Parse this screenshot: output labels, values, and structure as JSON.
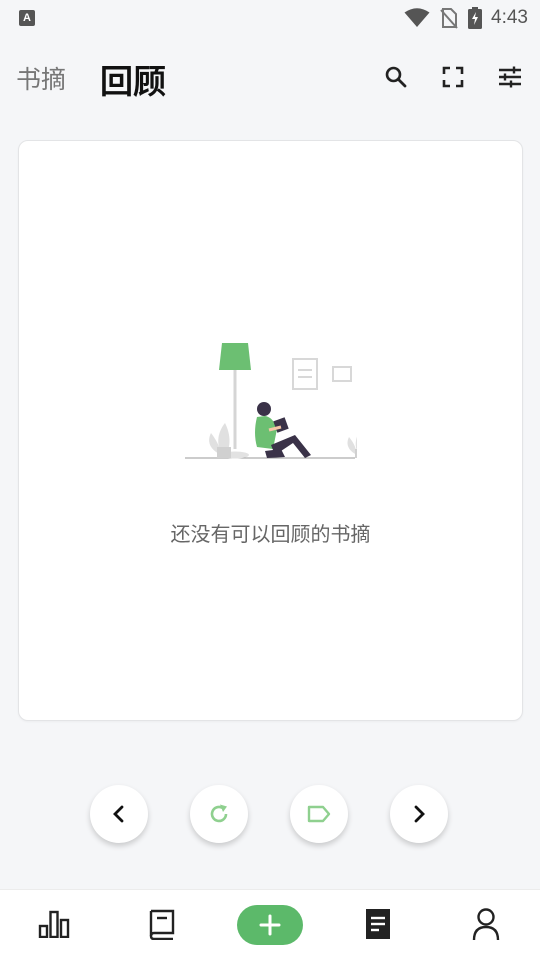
{
  "status_bar": {
    "time": "4:43",
    "app_icon_letter": "A",
    "icons": [
      "app-notification-icon",
      "wifi-icon",
      "no-sim-icon",
      "battery-charging-icon"
    ]
  },
  "header": {
    "tab_digest": "书摘",
    "tab_review": "回顾",
    "actions": [
      "search-icon",
      "fullscreen-icon",
      "filter-settings-icon"
    ]
  },
  "card": {
    "empty_message": "还没有可以回顾的书摘"
  },
  "controls": [
    "previous-icon",
    "refresh-icon",
    "tag-icon",
    "next-icon"
  ],
  "bottom_nav": {
    "items": [
      "stats-icon",
      "book-icon",
      "add-icon",
      "notes-icon",
      "profile-icon"
    ]
  },
  "colors": {
    "accent": "#5cb96a",
    "accent_light": "#8fd08f",
    "background": "#f5f6f8",
    "card": "#ffffff"
  }
}
